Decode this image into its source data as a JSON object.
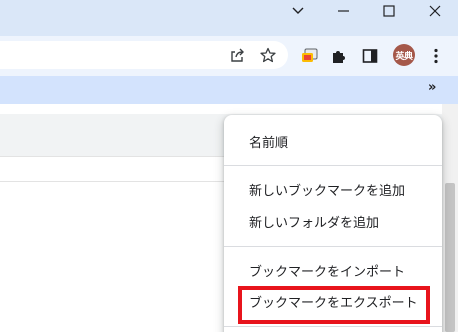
{
  "window": {
    "minimize_icon": "minimize-icon",
    "restore_icon": "chevron-down-icon",
    "maximize_icon": "maximize-icon",
    "close_icon": "close-icon"
  },
  "toolbar": {
    "profile_initials": "英典",
    "icons": [
      "share-icon",
      "star-icon",
      "extension-icon",
      "puzzle-icon",
      "side-panel-icon",
      "kebab-menu-icon"
    ]
  },
  "bookmarks_bar": {
    "overflow_label": "»"
  },
  "menu": {
    "items": [
      {
        "label": "名前順"
      },
      {
        "label": "新しいブックマークを追加"
      },
      {
        "label": "新しいフォルダを追加"
      },
      {
        "label": "ブックマークをインポート"
      },
      {
        "label": "ブックマークをエクスポート"
      }
    ]
  },
  "colors": {
    "highlight": "#e8141c",
    "titlebar": "#dae7f8",
    "bookmarks_bar": "#d3e3fd",
    "avatar": "#a5584a"
  }
}
